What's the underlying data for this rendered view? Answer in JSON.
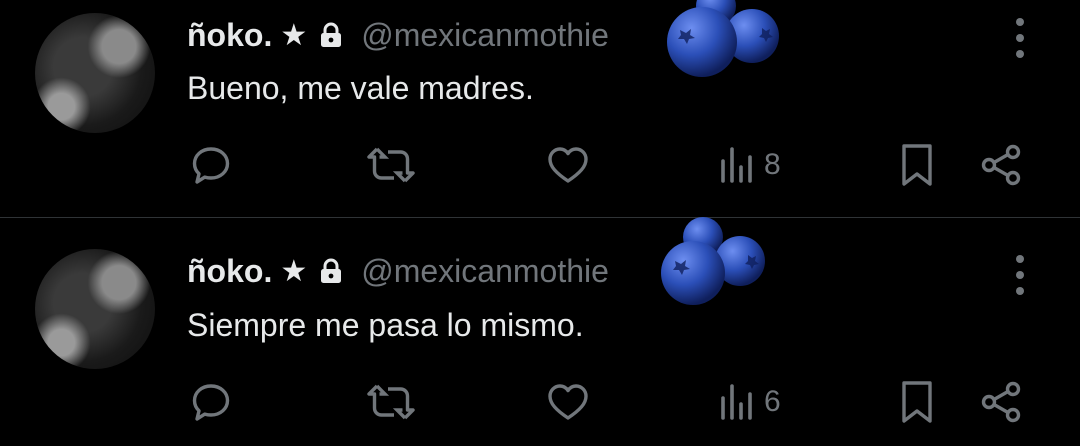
{
  "tweets": [
    {
      "display_name": "ñoko.",
      "star": "★",
      "handle": "@mexicanmothie",
      "text": "Bueno, me vale madres.",
      "views": "8"
    },
    {
      "display_name": "ñoko.",
      "star": "★",
      "handle": "@mexicanmothie",
      "text": "Siempre me pasa lo mismo.",
      "views": "6"
    }
  ],
  "icons": [
    "lock-icon",
    "blueberries-icon",
    "more-icon",
    "reply-icon",
    "retweet-icon",
    "like-icon",
    "views-icon",
    "bookmark-icon",
    "share-icon"
  ],
  "colors": {
    "background": "#000000",
    "text": "#e7e9ea",
    "secondary": "#71767b",
    "divider": "#2f3336",
    "berry": "#2b4fb8"
  }
}
